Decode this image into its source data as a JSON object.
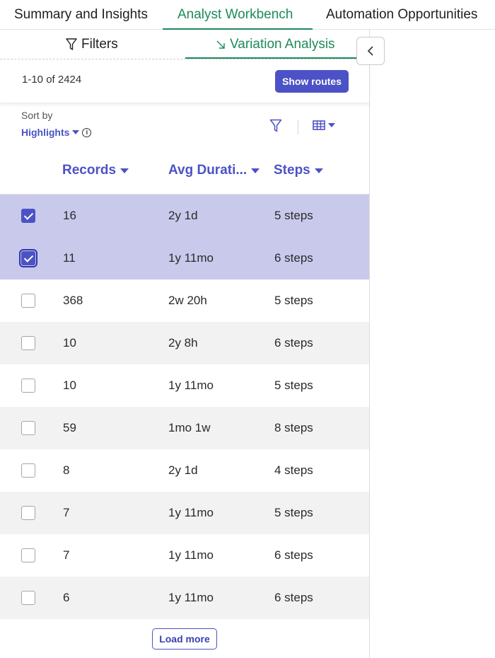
{
  "top_tabs": [
    {
      "label": "Summary and Insights"
    },
    {
      "label": "Analyst Workbench"
    },
    {
      "label": "Automation Opportunities"
    }
  ],
  "sub_tabs": [
    {
      "label": "Filters",
      "icon": "filter-icon"
    },
    {
      "label": "Variation Analysis",
      "icon": "arrow-down-right-icon"
    }
  ],
  "count_text": "1-10 of 2424",
  "show_routes_label": "Show routes",
  "sort": {
    "label": "Sort by",
    "value": "Highlights"
  },
  "columns": [
    {
      "label": "Records"
    },
    {
      "label": "Avg Durati..."
    },
    {
      "label": "Steps"
    }
  ],
  "rows": [
    {
      "records": "16",
      "duration": "2y 1d",
      "steps": "5 steps",
      "selected": true
    },
    {
      "records": "11",
      "duration": "1y 11mo",
      "steps": "6 steps",
      "selected": true
    },
    {
      "records": "368",
      "duration": "2w 20h",
      "steps": "5 steps",
      "selected": false
    },
    {
      "records": "10",
      "duration": "2y 8h",
      "steps": "6 steps",
      "selected": false
    },
    {
      "records": "10",
      "duration": "1y 11mo",
      "steps": "5 steps",
      "selected": false
    },
    {
      "records": "59",
      "duration": "1mo 1w",
      "steps": "8 steps",
      "selected": false
    },
    {
      "records": "8",
      "duration": "2y 1d",
      "steps": "4 steps",
      "selected": false
    },
    {
      "records": "7",
      "duration": "1y 11mo",
      "steps": "5 steps",
      "selected": false
    },
    {
      "records": "7",
      "duration": "1y 11mo",
      "steps": "6 steps",
      "selected": false
    },
    {
      "records": "6",
      "duration": "1y 11mo",
      "steps": "6 steps",
      "selected": false
    }
  ],
  "load_more_label": "Load more",
  "colors": {
    "accent": "#4c52c6",
    "active_tab": "#1d8a5c",
    "selected_row": "#c9c9ec"
  }
}
